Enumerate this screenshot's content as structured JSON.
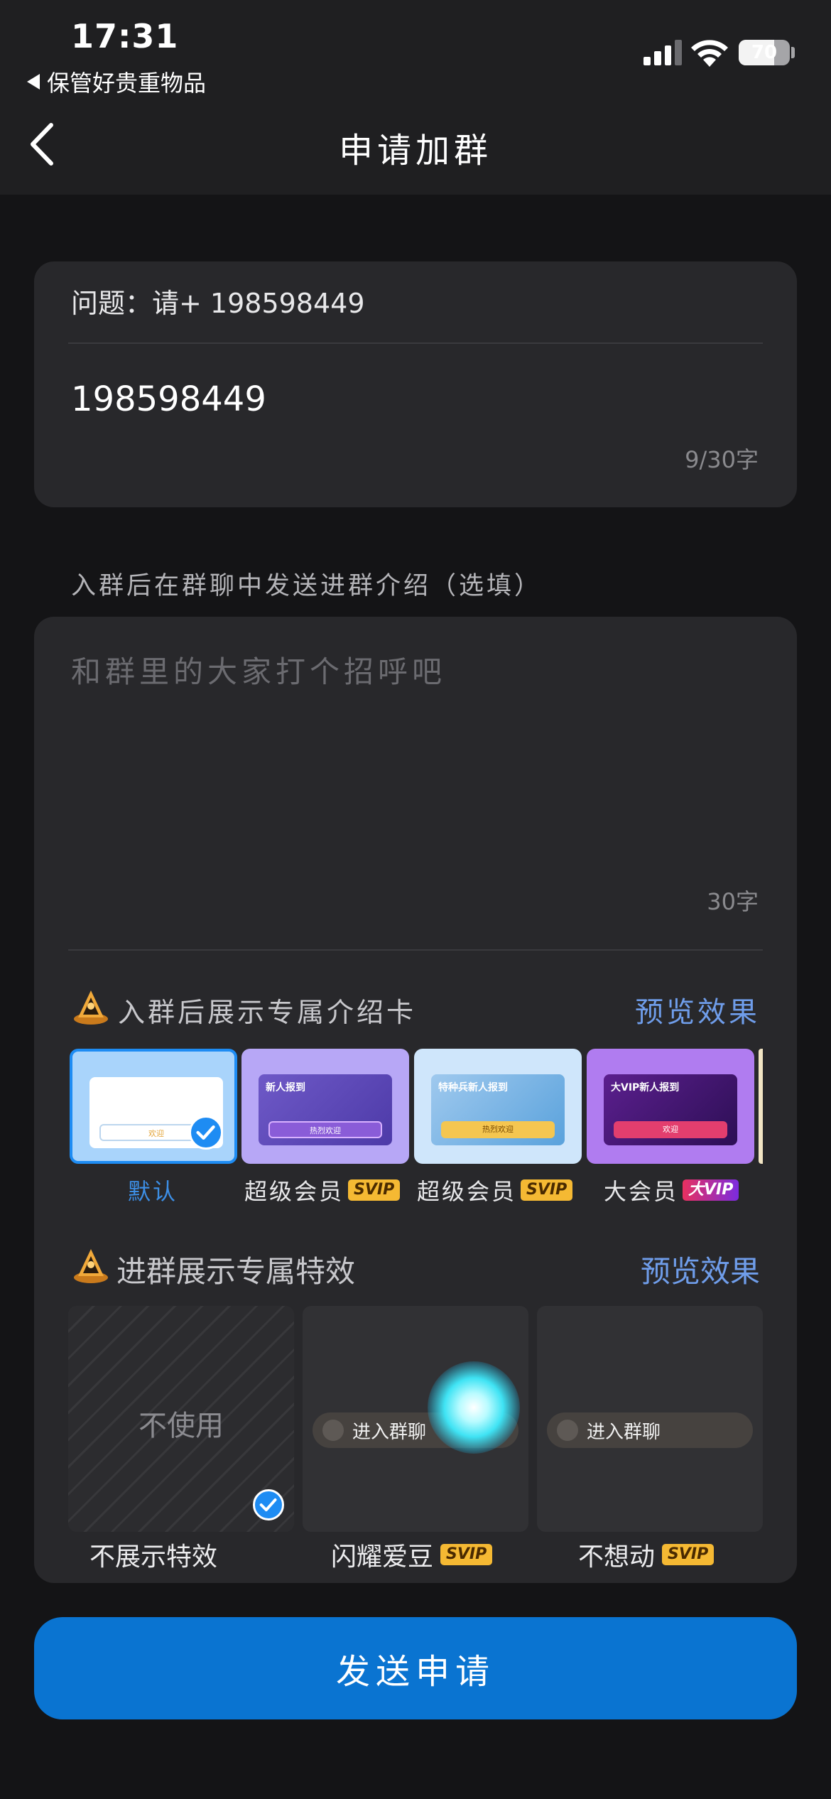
{
  "status_bar": {
    "time": "17:31",
    "back_app_label": "保管好贵重物品",
    "battery": "70"
  },
  "nav": {
    "title": "申请加群"
  },
  "question": {
    "label": "问题：请+ 198598449",
    "answer": "198598449",
    "count": "9/30字"
  },
  "intro": {
    "section_label": "入群后在群聊中发送进群介绍（选填）",
    "placeholder": "和群里的大家打个招呼吧",
    "count": "30字"
  },
  "intro_cards": {
    "title": "入群后展示专属介绍卡",
    "preview_label": "预览效果",
    "items": [
      {
        "label": "默认",
        "badge": "",
        "header": "",
        "button": "欢迎",
        "selected": true
      },
      {
        "label": "超级会员",
        "badge": "SVIP",
        "header": "新人报到",
        "button": "热烈欢迎",
        "selected": false
      },
      {
        "label": "超级会员",
        "badge": "SVIP",
        "header": "特种兵新人报到",
        "button": "热烈欢迎",
        "selected": false
      },
      {
        "label": "大会员",
        "badge": "大VIP",
        "header": "大VIP新人报到",
        "button": "欢迎",
        "selected": false
      }
    ]
  },
  "effects": {
    "title": "进群展示专属特效",
    "preview_label": "预览效果",
    "none_text": "不使用",
    "pill_text": "进入群聊",
    "items": [
      {
        "label": "不展示特效",
        "badge": "",
        "selected": true
      },
      {
        "label": "闪耀爱豆",
        "badge": "SVIP",
        "selected": false
      },
      {
        "label": "不想动",
        "badge": "SVIP",
        "selected": false
      }
    ]
  },
  "send_button": "发送申请",
  "colors": {
    "accent": "#0a74d1",
    "link": "#6f9dea",
    "svip": "#f5b933",
    "card": "#28282b"
  }
}
